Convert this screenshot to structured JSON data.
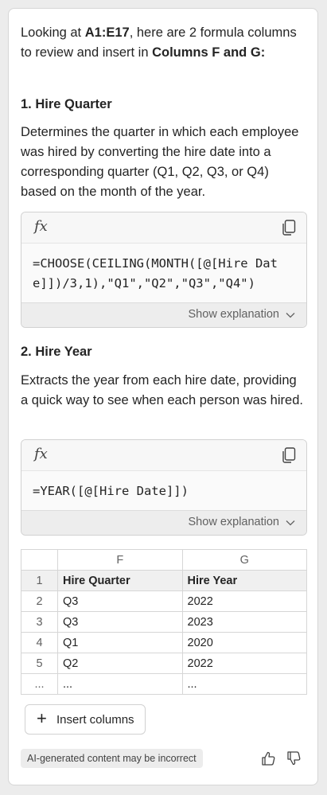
{
  "intro": {
    "prefix": "Looking at ",
    "range": "A1:E17",
    "middle": ", here are 2 formula columns to review and insert in ",
    "columns": "Columns F and G",
    "suffix": ":"
  },
  "formulas": [
    {
      "heading": "1. Hire Quarter",
      "description": "Determines the quarter in which each employee was hired by converting the hire date into a corresponding quarter (Q1, Q2, Q3, or Q4) based on the month of the year.",
      "fx_label": "fx",
      "code": "=CHOOSE(CEILING(MONTH([@[Hire Date]])/3,1),\"Q1\",\"Q2\",\"Q3\",\"Q4\")",
      "explanation_label": "Show explanation"
    },
    {
      "heading": "2. Hire Year",
      "description": "Extracts the year from each hire date, providing a quick way to see when each person was hired.",
      "fx_label": "fx",
      "code": "=YEAR([@[Hire Date]])",
      "explanation_label": "Show explanation"
    }
  ],
  "preview_table": {
    "column_letters": [
      "F",
      "G"
    ],
    "rows": [
      {
        "num": "1",
        "cells": [
          "Hire Quarter",
          "Hire Year"
        ]
      },
      {
        "num": "2",
        "cells": [
          "Q3",
          "2022"
        ]
      },
      {
        "num": "3",
        "cells": [
          "Q3",
          "2023"
        ]
      },
      {
        "num": "4",
        "cells": [
          "Q1",
          "2020"
        ]
      },
      {
        "num": "5",
        "cells": [
          "Q2",
          "2022"
        ]
      },
      {
        "num": "...",
        "cells": [
          "...",
          "..."
        ]
      }
    ]
  },
  "insert_button": {
    "plus": "+",
    "label": "Insert columns"
  },
  "disclaimer": "AI-generated content may be incorrect",
  "icons": {
    "copy": "copy-icon",
    "chevron": "chevron-down-icon",
    "thumbs_up": "thumbs-up-icon",
    "thumbs_down": "thumbs-down-icon"
  }
}
